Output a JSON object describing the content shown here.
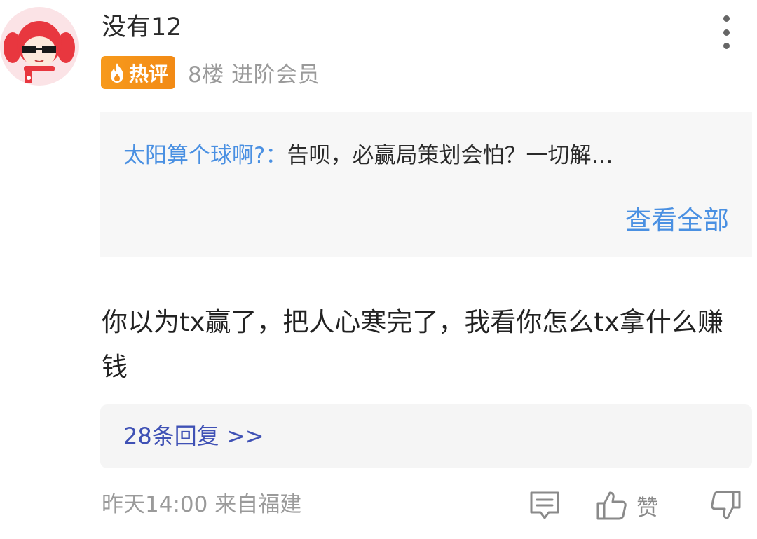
{
  "comment": {
    "username": "没有12",
    "badge": {
      "label": "热评",
      "icon": "flame-icon",
      "color": "#f5901a"
    },
    "floor_info": "8楼 进阶会员",
    "quote": {
      "author": "太阳算个球啊?：",
      "text": "告呗，必赢局策划会怕？一切解…",
      "view_all": "查看全部"
    },
    "body": "你以为tx赢了，把人心寒完了，我看你怎么tx拿什么赚钱",
    "replies_link": "28条回复 >>",
    "time_location": "昨天14:00 来自福建",
    "actions": {
      "comment_icon": "comment-icon",
      "like_icon": "thumbs-up-icon",
      "like_label": "赞",
      "dislike_icon": "thumbs-down-icon"
    },
    "more_icon": "more-vertical-icon"
  },
  "colors": {
    "link_blue": "#4a90e2",
    "reply_blue": "#3f51b5",
    "meta_gray": "#9a9a9a",
    "avatar_bg": "#fbe3e6",
    "avatar_hair": "#e8373f"
  }
}
